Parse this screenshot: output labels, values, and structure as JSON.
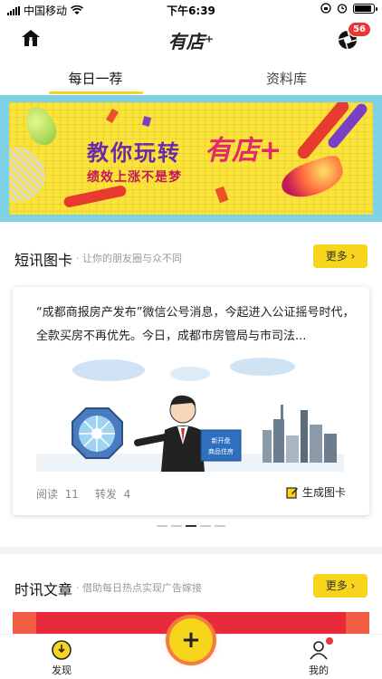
{
  "status_bar": {
    "carrier": "中国移动",
    "time": "下午6:39"
  },
  "header": {
    "logo_text": "有店⁺",
    "notification_count": "56"
  },
  "tabs": [
    {
      "label": "每日一荐",
      "active": true
    },
    {
      "label": "资料库",
      "active": false
    }
  ],
  "banner": {
    "title": "教你玩转",
    "brand": "有店+",
    "subtitle": "绩效上涨不是梦"
  },
  "section_cards": {
    "title": "短讯图卡",
    "subtitle": "让你的朋友圈与众不同",
    "more_label": "更多 ›"
  },
  "card": {
    "text": "“成都商报房产发布”微信公号消息，今起进入公证摇号时代，全款买房不再优先。今日，成都市房管局与市司法...",
    "image_sign_text": "新开盘\n商品住房",
    "read_label": "阅读",
    "read_count": "11",
    "share_label": "转发",
    "share_count": "4",
    "generate_label": "生成图卡"
  },
  "section_articles": {
    "title": "时讯文章",
    "subtitle": "借助每日热点实现广告嫁接",
    "more_label": "更多 ›"
  },
  "bottom_nav": {
    "discover_label": "发现",
    "center_label": "+",
    "mine_label": "我的"
  },
  "colors": {
    "accent": "#f7d51c",
    "badge": "#e53935"
  }
}
